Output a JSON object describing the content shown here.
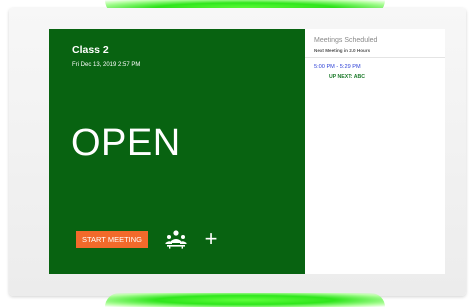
{
  "room": {
    "name": "Class 2",
    "datetime": "Fri Dec 13, 2019 2:57 PM",
    "status": "OPEN"
  },
  "actions": {
    "start_meeting_label": "START MEETING",
    "people_icon": "people-icon",
    "add_icon": "add-icon",
    "add_glyph": "+"
  },
  "schedule": {
    "title": "Meetings Scheduled",
    "next_meeting": "Next Meeting in 2.0 Hours",
    "meetings": [
      {
        "time": "5:00 PM - 5:29 PM",
        "label": "UP NEXT: ABC"
      }
    ]
  },
  "colors": {
    "status_green": "#086311",
    "button_orange": "#f26a2b",
    "led_green": "#2fe61c",
    "time_blue": "#2b3fd6",
    "upnext_green": "#1d7a2b"
  }
}
